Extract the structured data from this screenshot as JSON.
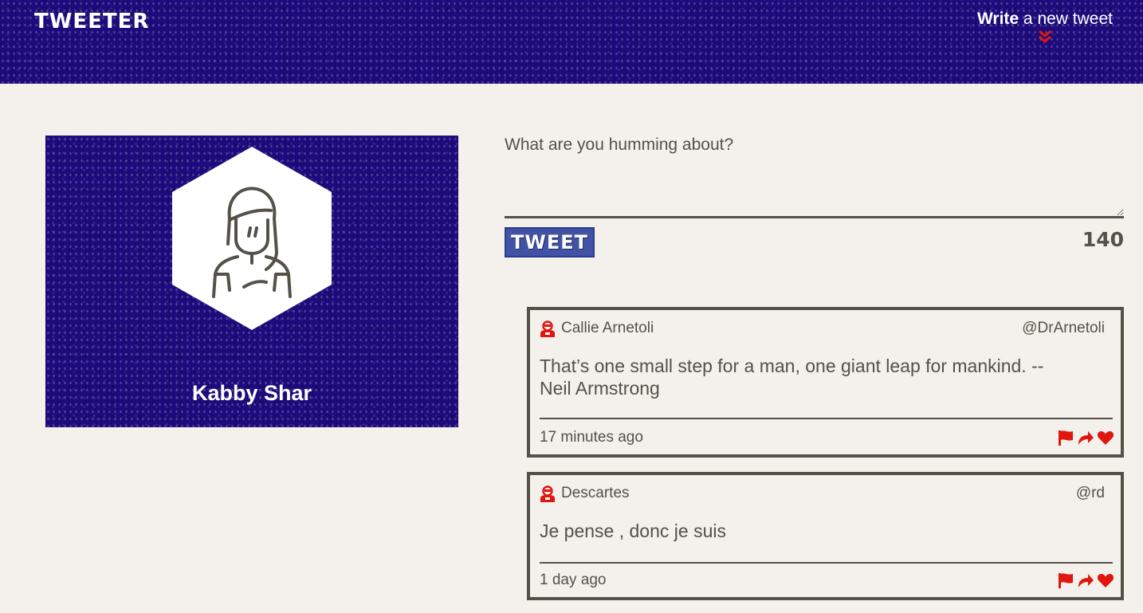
{
  "nav": {
    "brand": "TWEETER",
    "compose_strong": "Write",
    "compose_rest": " a new tweet",
    "toggle_icon": "double-chevron-down-icon"
  },
  "profile": {
    "name": "Kabby Shar",
    "avatar_icon": "woman-avatar-icon"
  },
  "compose": {
    "placeholder": "What are you humming about?",
    "value": "",
    "button_label": "TWEET",
    "counter": "140"
  },
  "tweets": [
    {
      "name": "Callie Arnetoli",
      "handle": "@DrArnetoli",
      "content": "That’s one small step for a man, one giant leap for mankind. --Neil Armstrong",
      "time": "17 minutes ago"
    },
    {
      "name": "Descartes",
      "handle": "@rd",
      "content": "Je pense , donc je suis",
      "time": "1 day ago"
    }
  ],
  "colors": {
    "header_bg": "#1d0b7b",
    "page_bg": "#f4f1ec",
    "text": "#545149",
    "accent_red": "#e0160f",
    "button_blue": "#4252a5"
  }
}
